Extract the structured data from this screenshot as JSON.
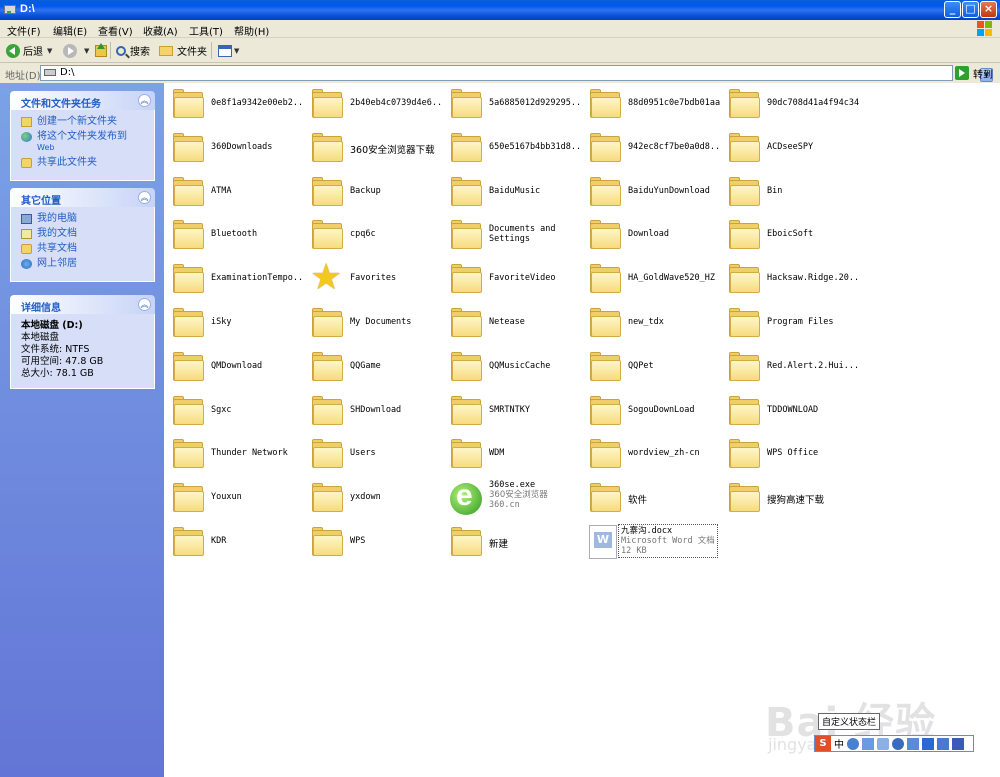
{
  "window": {
    "title": "D:\\",
    "buttons": {
      "minimize": "_",
      "maximize": "□",
      "close": "×"
    }
  },
  "menu": [
    "文件(F)",
    "编辑(E)",
    "查看(V)",
    "收藏(A)",
    "工具(T)",
    "帮助(H)"
  ],
  "toolbar": {
    "back_label": "后退",
    "search_label": "搜索",
    "folders_label": "文件夹"
  },
  "address": {
    "label": "地址(D)",
    "value": "D:\\",
    "go_label": "转到"
  },
  "taskpane": {
    "file_tasks": {
      "title": "文件和文件夹任务",
      "items": [
        "创建一个新文件夹",
        "将这个文件夹发布到",
        "Web",
        "共享此文件夹"
      ]
    },
    "other_places": {
      "title": "其它位置",
      "items": [
        "我的电脑",
        "我的文档",
        "共享文档",
        "网上邻居"
      ]
    },
    "details": {
      "title": "详细信息",
      "drive_name": "本地磁盘 (D:)",
      "drive_type": "本地磁盘",
      "filesystem": "文件系统: NTFS",
      "free": "可用空间: 47.8 GB",
      "total": "总大小: 78.1 GB"
    }
  },
  "files": [
    {
      "name": "0e8f1a9342e00eb2...",
      "type": "folder"
    },
    {
      "name": "2b40eb4c0739d4e6...",
      "type": "folder"
    },
    {
      "name": "5a6885012d929295...",
      "type": "folder"
    },
    {
      "name": "88d0951c0e7bdb01aa",
      "type": "folder"
    },
    {
      "name": "90dc708d41a4f94c34",
      "type": "folder"
    },
    {
      "name": "360Downloads",
      "type": "folder"
    },
    {
      "name": "360安全浏览器下载",
      "type": "folder"
    },
    {
      "name": "650e5167b4bb31d8...",
      "type": "folder"
    },
    {
      "name": "942ec8cf7be0a0d8...",
      "type": "folder"
    },
    {
      "name": "ACDseeSPY",
      "type": "folder"
    },
    {
      "name": "ATMA",
      "type": "folder"
    },
    {
      "name": "Backup",
      "type": "folder"
    },
    {
      "name": "BaiduMusic",
      "type": "folder"
    },
    {
      "name": "BaiduYunDownload",
      "type": "folder"
    },
    {
      "name": "Bin",
      "type": "folder"
    },
    {
      "name": "Bluetooth",
      "type": "folder"
    },
    {
      "name": "cpq6c",
      "type": "folder"
    },
    {
      "name": "Documents and Settings",
      "type": "folder"
    },
    {
      "name": "Download",
      "type": "folder"
    },
    {
      "name": "EboicSoft",
      "type": "folder"
    },
    {
      "name": "ExaminationTempo...",
      "type": "folder"
    },
    {
      "name": "Favorites",
      "type": "favorites"
    },
    {
      "name": "FavoriteVideo",
      "type": "folder"
    },
    {
      "name": "HA_GoldWave520_HZ",
      "type": "folder"
    },
    {
      "name": "Hacksaw.Ridge.20...",
      "type": "folder"
    },
    {
      "name": "iSky",
      "type": "folder"
    },
    {
      "name": "My Documents",
      "type": "folder"
    },
    {
      "name": "Netease",
      "type": "folder"
    },
    {
      "name": "new_tdx",
      "type": "folder"
    },
    {
      "name": "Program Files",
      "type": "folder"
    },
    {
      "name": "QMDownload",
      "type": "folder"
    },
    {
      "name": "QQGame",
      "type": "folder"
    },
    {
      "name": "QQMusicCache",
      "type": "folder"
    },
    {
      "name": "QQPet",
      "type": "folder"
    },
    {
      "name": "Red.Alert.2.Hui....",
      "type": "folder"
    },
    {
      "name": "Sgxc",
      "type": "folder"
    },
    {
      "name": "SHDownload",
      "type": "folder"
    },
    {
      "name": "SMRTNTKY",
      "type": "folder"
    },
    {
      "name": "SogouDownLoad",
      "type": "folder"
    },
    {
      "name": "TDDOWNLOAD",
      "type": "folder"
    },
    {
      "name": "Thunder Network",
      "type": "folder"
    },
    {
      "name": "Users",
      "type": "folder"
    },
    {
      "name": "WDM",
      "type": "folder"
    },
    {
      "name": "wordview_zh-cn",
      "type": "folder"
    },
    {
      "name": "WPS Office",
      "type": "folder"
    },
    {
      "name": "Youxun",
      "type": "folder"
    },
    {
      "name": "yxdown",
      "type": "folder"
    },
    {
      "name": "360se.exe",
      "type": "exe",
      "line2": "360安全浏览器",
      "line3": "360.cn"
    },
    {
      "name": "软件",
      "type": "folder"
    },
    {
      "name": "搜狗高速下载",
      "type": "folder"
    },
    {
      "name": "KDR",
      "type": "folder"
    },
    {
      "name": "WPS",
      "type": "folder"
    },
    {
      "name": "新建",
      "type": "folder"
    },
    {
      "name": "九寨沟.docx",
      "type": "doc",
      "line2": "Microsoft Word 文档",
      "line3": "12 KB"
    }
  ],
  "overlay": {
    "watermark": "Bai 经验",
    "watermark_sub": "jingyan.baidu.com",
    "tooltip": "自定义状态栏",
    "ime_logo": "S",
    "ime_mode": "中"
  }
}
